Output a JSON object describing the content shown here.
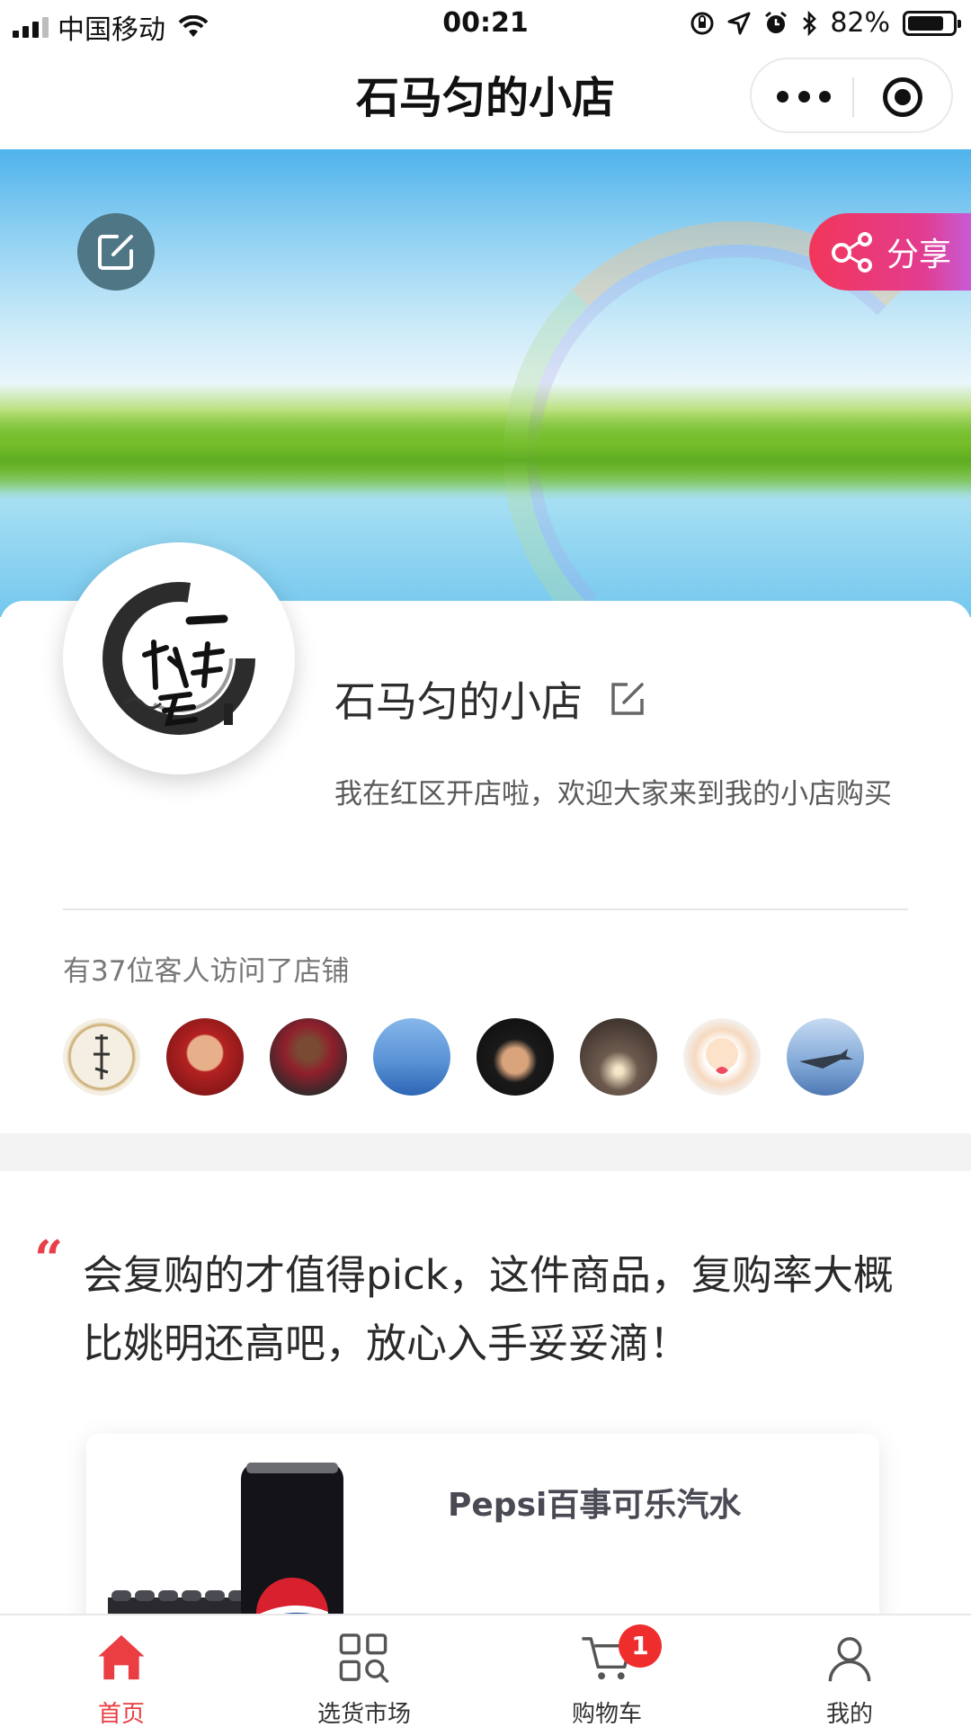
{
  "status_bar": {
    "carrier": "中国移动",
    "time": "00:21",
    "battery": "82%",
    "battery_level": 0.82
  },
  "nav": {
    "title": "石马匀的小店"
  },
  "banner": {
    "share_label": "分享"
  },
  "shop": {
    "name": "石马匀的小店",
    "description": "我在红区开店啦，欢迎大家来到我的小店购买",
    "visitors_text": "有37位客人访问了店铺",
    "visitor_avatars": [
      "avatar-1",
      "avatar-2",
      "avatar-3",
      "avatar-4",
      "avatar-5",
      "avatar-6",
      "avatar-7",
      "avatar-8"
    ]
  },
  "recommendation": {
    "quote_mark": "“",
    "text": "会复购的才值得pick，这件商品，复购率大概比姚明还高吧，放心入手妥妥滴！"
  },
  "product": {
    "name": "Pepsi百事可乐汽水"
  },
  "tab_bar": {
    "tabs": [
      {
        "label": "首页",
        "icon": "home-icon",
        "active": true
      },
      {
        "label": "选货市场",
        "icon": "market-grid-icon",
        "active": false
      },
      {
        "label": "购物车",
        "icon": "cart-icon",
        "active": false,
        "badge": "1"
      },
      {
        "label": "我的",
        "icon": "profile-icon",
        "active": false
      }
    ]
  },
  "colors": {
    "accent": "#ea3e43",
    "share_gradient_start": "#f2365a",
    "share_gradient_end": "#c75bd6",
    "badge": "#ef2d2d"
  }
}
